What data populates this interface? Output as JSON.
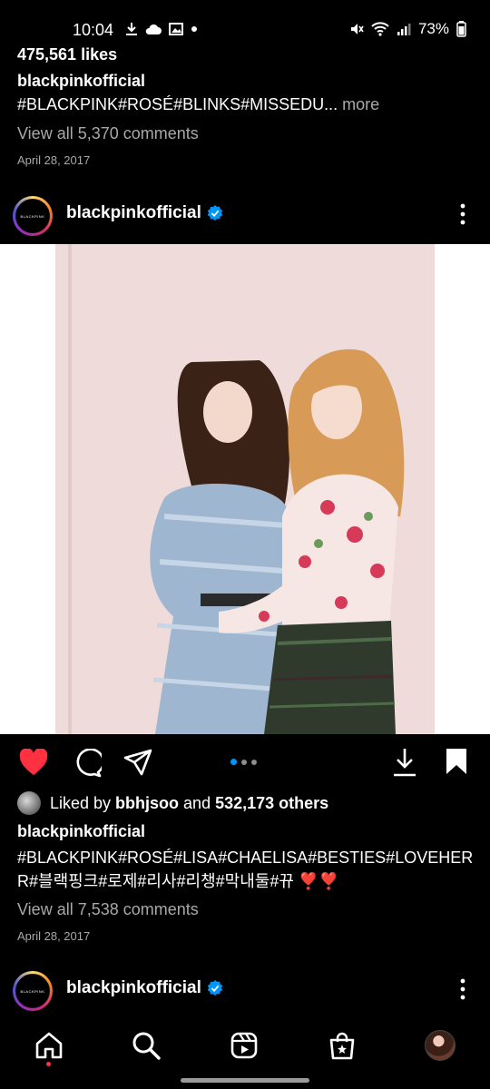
{
  "status_bar": {
    "time": "10:04",
    "battery": "73%"
  },
  "post1": {
    "likes": "475,561 likes",
    "owner": "blackpinkofficial",
    "caption_tags": "#BLACKPINK#ROSÉ#BLINKS#MISSEDU...",
    "more_label": " more",
    "view_comments": "View all 5,370 comments",
    "date": "April 28, 2017"
  },
  "post2": {
    "avatar_text": "BLACKPINK",
    "username": "blackpinkofficial",
    "liked_by_prefix": "Liked by ",
    "liked_by_user": "bbhjsoo",
    "liked_by_mid": " and ",
    "liked_by_count": "532,173 others",
    "owner": "blackpinkofficial",
    "caption": "#BLACKPINK#ROSÉ#LISA#CHAELISA#BESTIES#LOVEHERR#블랙핑크#로제#리사#리챙#막내둘#뀨 ❣️❣️",
    "view_comments": "View all 7,538 comments",
    "date": "April 28, 2017"
  },
  "post3": {
    "avatar_text": "BLACKPINK",
    "username": "blackpinkofficial"
  },
  "icons": {
    "like": "heart-icon",
    "comment": "comment-icon",
    "share": "send-icon",
    "download": "download-icon",
    "save": "bookmark-icon",
    "more": "kebab-icon"
  },
  "colors": {
    "like_red": "#ff3040",
    "verified_blue": "#0095f6",
    "carousel_active": "#0095f6"
  }
}
